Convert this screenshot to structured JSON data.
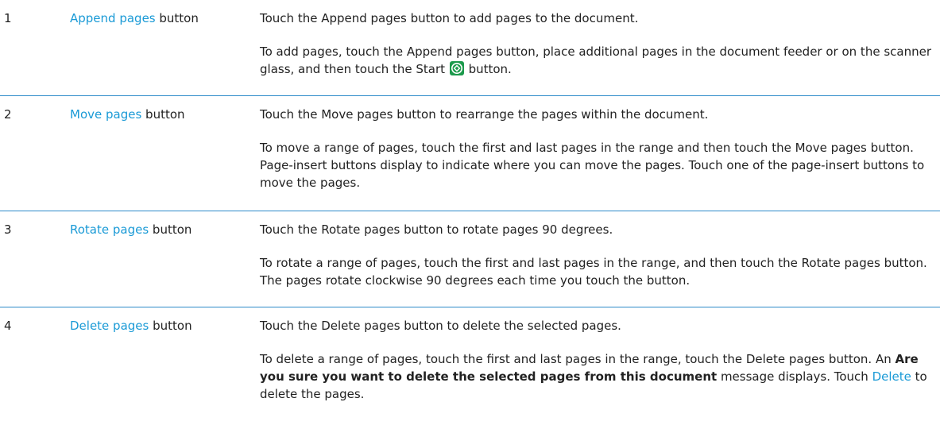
{
  "rows": [
    {
      "number": "1",
      "item_link": "Append pages",
      "item_suffix": " button",
      "desc1": "Touch the Append pages button to add pages to the document.",
      "desc2_before_icon": "To add pages, touch the Append pages button, place additional pages in the document feeder or on the scanner glass, and then touch the Start ",
      "desc2_after_icon": " button.",
      "icon": "start-icon"
    },
    {
      "number": "2",
      "item_link": "Move pages",
      "item_suffix": " button",
      "desc1": "Touch the Move pages button to rearrange the pages within the document.",
      "desc2": "To move a range of pages, touch the first and last pages in the range and then touch the Move pages button. Page-insert buttons display to indicate where you can move the pages. Touch one of the page-insert buttons to move the pages."
    },
    {
      "number": "3",
      "item_link": "Rotate pages",
      "item_suffix": " button",
      "desc1": "Touch the Rotate pages button to rotate pages 90 degrees.",
      "desc2": "To rotate a range of pages, touch the first and last pages in the range, and then touch the Rotate pages button. The pages rotate clockwise 90 degrees each time you touch the button."
    },
    {
      "number": "4",
      "item_link": "Delete pages",
      "item_suffix": " button",
      "desc1": "Touch the Delete pages button to delete the selected pages.",
      "desc2_before_bold": "To delete a range of pages, touch the first and last pages in the range, touch the Delete pages button. An ",
      "desc2_bold": "Are you sure you want to delete the selected pages from this document",
      "desc2_after_bold": " message displays. Touch ",
      "desc2_link": "Delete",
      "desc2_end": " to delete the pages."
    }
  ],
  "colors": {
    "link": "#1a9ad6",
    "divider": "#2d8bc9",
    "start_icon_bg": "#1c9a4c"
  }
}
